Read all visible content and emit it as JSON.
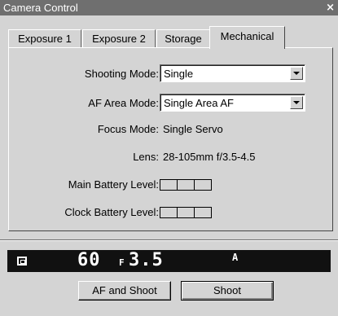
{
  "window": {
    "title": "Camera Control",
    "close_glyph": "×"
  },
  "tabs": [
    {
      "label": "Exposure 1"
    },
    {
      "label": "Exposure 2"
    },
    {
      "label": "Storage"
    },
    {
      "label": "Mechanical",
      "active": true
    }
  ],
  "fields": {
    "shooting_mode": {
      "label": "Shooting Mode:",
      "value": "Single"
    },
    "af_area_mode": {
      "label": "AF Area Mode:",
      "value": "Single Area AF"
    },
    "focus_mode": {
      "label": "Focus Mode:",
      "value": "Single Servo"
    },
    "lens": {
      "label": "Lens:",
      "value": "28-105mm f/3.5-4.5"
    },
    "main_battery": {
      "label": "Main Battery Level:"
    },
    "clock_battery": {
      "label": "Clock Battery Level:"
    }
  },
  "lcd": {
    "metering_icon": "matrix-metering-icon",
    "shutter": "60",
    "aperture_prefix": "F",
    "aperture": "3.5",
    "mode": "A"
  },
  "buttons": {
    "af_and_shoot": "AF and Shoot",
    "shoot": "Shoot"
  }
}
